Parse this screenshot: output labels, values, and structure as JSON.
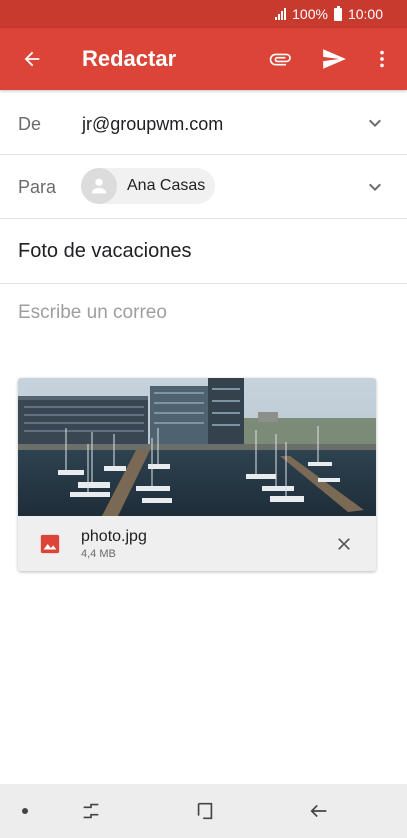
{
  "status_bar": {
    "battery": "100%",
    "time": "10:00",
    "color": "#c83a2e"
  },
  "app_bar": {
    "title": "Redactar",
    "color": "#db4437",
    "icons": [
      "back-arrow-icon",
      "paperclip-icon",
      "send-icon",
      "more-vert-icon"
    ]
  },
  "compose": {
    "from_label": "De",
    "from_value": "jr@groupwm.com",
    "to_label": "Para",
    "to_recipient": "Ana Casas",
    "subject": "Foto de vacaciones",
    "body_placeholder": "Escribe un correo"
  },
  "attachment": {
    "filename": "photo.jpg",
    "size": "4,4 MB",
    "icon": "image-icon",
    "icon_color": "#db4437"
  },
  "nav_bar": {
    "icons": [
      "dot-icon",
      "recents-icon",
      "home-icon",
      "back-icon"
    ]
  }
}
